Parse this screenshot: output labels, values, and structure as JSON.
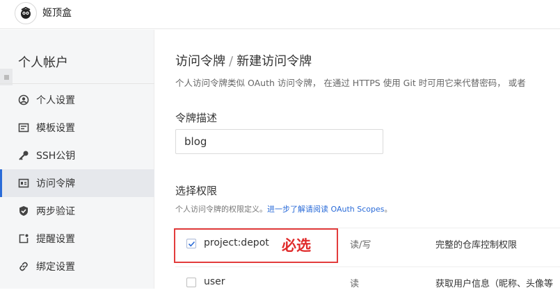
{
  "header": {
    "site_name": "姬顶盒",
    "logo_icon": "juejin-logo-icon"
  },
  "sidebar": {
    "title": "个人帐户",
    "items": [
      {
        "label": "个人设置",
        "icon": "user-circle-icon",
        "active": false
      },
      {
        "label": "模板设置",
        "icon": "template-icon",
        "active": false
      },
      {
        "label": "SSH公钥",
        "icon": "key-icon",
        "active": false
      },
      {
        "label": "访问令牌",
        "icon": "token-icon",
        "active": true
      },
      {
        "label": "两步验证",
        "icon": "shield-check-icon",
        "active": false
      },
      {
        "label": "提醒设置",
        "icon": "notification-icon",
        "active": false
      },
      {
        "label": "绑定设置",
        "icon": "link-icon",
        "active": false
      }
    ]
  },
  "main": {
    "breadcrumb_parent": "访问令牌",
    "breadcrumb_sep": "/",
    "breadcrumb_current": "新建访问令牌",
    "description": "个人访问令牌类似 OAuth 访问令牌， 在通过 HTTPS 使用 Git 时可用它来代替密码， 或者",
    "token_desc_label": "令牌描述",
    "token_desc_value": "blog",
    "scope_title": "选择权限",
    "scope_sub_prefix": "个人访问令牌的权限定义。",
    "scope_sub_link": "进一步了解请阅读 OAuth Scopes",
    "scope_sub_suffix": "。",
    "scopes": [
      {
        "name": "project:depot",
        "access": "读/写",
        "detail": "完整的仓库控制权限",
        "checked": true
      },
      {
        "name": "user",
        "access": "读",
        "detail": "获取用户信息（昵称、头像等",
        "checked": false
      }
    ],
    "annotation_required": "必选"
  },
  "colors": {
    "accent": "#2a6bd8",
    "annotation": "#e02a2a"
  }
}
